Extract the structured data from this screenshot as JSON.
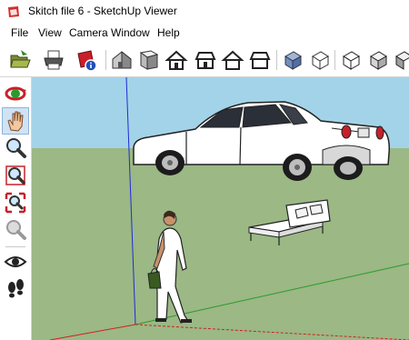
{
  "window": {
    "title": "Skitch file 6 - SketchUp Viewer"
  },
  "menu": {
    "items": [
      "File",
      "View",
      "Camera",
      "Window",
      "Help"
    ]
  },
  "colors": {
    "sky": "#9fd0e6",
    "ground": "#9bb885",
    "accent_red": "#c8202a",
    "axis_blue": "#1f2bd6",
    "axis_green": "#2a9a2a",
    "axis_red": "#d02020"
  },
  "toolbar": {
    "icons": [
      "open-icon",
      "print-icon",
      "model-info-icon",
      "iso-view-icon",
      "top-view-icon",
      "front-view-icon",
      "right-view-icon",
      "back-view-icon",
      "left-view-icon",
      "xray-style-icon",
      "wireframe-style-icon",
      "hidden-line-style-icon",
      "shaded-style-icon",
      "shaded-textures-style-icon",
      "monochrome-style-icon"
    ]
  },
  "sidebar": {
    "tools": [
      "orbit-icon",
      "pan-icon",
      "zoom-icon",
      "zoom-window-icon",
      "zoom-extents-icon",
      "previous-view-icon",
      "look-around-icon",
      "walk-icon"
    ]
  },
  "scene": {
    "objects": [
      "car",
      "bed",
      "person",
      "axes"
    ]
  }
}
